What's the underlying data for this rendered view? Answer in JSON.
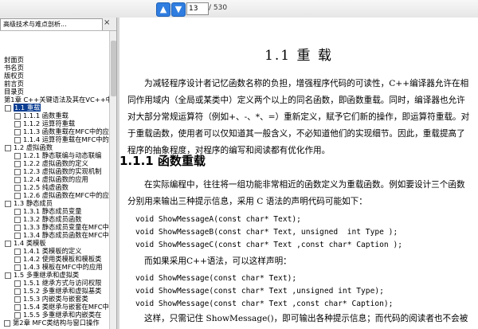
{
  "toolbar": {
    "page_current": "13",
    "page_total": "/ 530",
    "up_icon": "arrow-up-icon",
    "down_icon": "arrow-down-icon"
  },
  "tab": {
    "title": "高级技术与难点剖析...",
    "close": "×"
  },
  "tree": [
    {
      "label": "封面页",
      "indent": 5,
      "box": ""
    },
    {
      "label": "书名页",
      "indent": 5,
      "box": ""
    },
    {
      "label": "版权页",
      "indent": 5,
      "box": ""
    },
    {
      "label": "前言页",
      "indent": 5,
      "box": ""
    },
    {
      "label": "目录页",
      "indent": 5,
      "box": ""
    },
    {
      "label": "第1章  C++关键语法及其在VC++中的",
      "indent": 5,
      "box": ""
    },
    {
      "label": "1.1 重载",
      "indent": 6,
      "box": "-",
      "sel": true
    },
    {
      "label": "1.1.1 函数重载",
      "indent": 18,
      "box": " "
    },
    {
      "label": "1.1.2 运算符重载",
      "indent": 18,
      "box": " "
    },
    {
      "label": "1.1.3 函数重载在MFC中的应",
      "indent": 18,
      "box": " "
    },
    {
      "label": "1.1.4 运算符重载在MFC中的",
      "indent": 18,
      "box": " "
    },
    {
      "label": "1.2 虚拟函数",
      "indent": 6,
      "box": "-"
    },
    {
      "label": "1.2.1 静态联编与动态联编",
      "indent": 18,
      "box": " "
    },
    {
      "label": "1.2.2 虚拟函数的定义",
      "indent": 18,
      "box": " "
    },
    {
      "label": "1.2.3 虚拟函数的实现机制",
      "indent": 18,
      "box": " "
    },
    {
      "label": "1.2.4 虚拟函数的应用",
      "indent": 18,
      "box": " "
    },
    {
      "label": "1.2.5 纯虚函数",
      "indent": 18,
      "box": " "
    },
    {
      "label": "1.2.6 虚拟函数在MFC中的应",
      "indent": 18,
      "box": " "
    },
    {
      "label": "1.3 静态成员",
      "indent": 6,
      "box": "-"
    },
    {
      "label": "1.3.1 静态成员变量",
      "indent": 18,
      "box": " "
    },
    {
      "label": "1.3.2 静态成员函数",
      "indent": 18,
      "box": " "
    },
    {
      "label": "1.3.3 静态成员变量在MFC中",
      "indent": 18,
      "box": " "
    },
    {
      "label": "1.3.4 静态成员函数在MFC中",
      "indent": 18,
      "box": " "
    },
    {
      "label": "1.4 类模板",
      "indent": 6,
      "box": "-"
    },
    {
      "label": "1.4.1 类模板的定义",
      "indent": 18,
      "box": " "
    },
    {
      "label": "1.4.2 使用类模板和模板类",
      "indent": 18,
      "box": " "
    },
    {
      "label": "1.4.3 模板在MFC中的应用",
      "indent": 18,
      "box": " "
    },
    {
      "label": "1.5 多重继承和虚拟类",
      "indent": 6,
      "box": "-"
    },
    {
      "label": "1.5.1 继承方式与访问权限",
      "indent": 18,
      "box": " "
    },
    {
      "label": "1.5.2 多重继承和虚拟基类",
      "indent": 18,
      "box": " "
    },
    {
      "label": "1.5.3 内嵌类与嵌套类",
      "indent": 18,
      "box": " "
    },
    {
      "label": "1.5.4 类继承与嵌套在MFC中",
      "indent": 18,
      "box": " "
    },
    {
      "label": "1.5.5 多重继承和内嵌类在",
      "indent": 18,
      "box": " "
    },
    {
      "label": "第2章  MFC类结构与窗口操作",
      "indent": 5,
      "box": "+"
    }
  ],
  "content": {
    "section_title": "1.1  重    载",
    "para1": "为减轻程序设计者记忆函数名称的负担，增强程序代码的可读性，C++编译器允许在相同作用域内（全局或某类中）定义两个以上的同名函数，即函数重载。同时，编译器也允许对大部分常规运算符（例如+、-、*、=）重新定义，赋予它们新的操作，即运算符重载。对于重载函数，使用者可以仅知道其一般含义，不必知道他们的实现细节。因此，重载提高了程序的抽象程度，对程序的编写和阅读都有优化作用。",
    "h2": "1.1.1   函数重载",
    "para2": "在实际编程中，往往将一组功能非常相近的函数定义为重载函数。例如要设计三个函数分别用来输出三种提示信息，采用 C 语法的声明代码可能如下：",
    "code1": [
      "void ShowMessageA(const char* Text);",
      "void ShowMessageB(const char* Text, unsigned  int Type );",
      "void ShowMessageC(const char* Text ,const char* Caption );"
    ],
    "para3": "而如果采用C++语法，可以这样声明：",
    "code2": [
      "void ShowMessage(const char* Text);",
      "void ShowMessage(const char* Text ,unsigned int Type);",
      "void ShowMessage(const char* Text ,const char* Caption);"
    ],
    "para4": "这样，只需记住 ShowMessage()，即可输出各种提示信息；而代码的阅读者也不会被"
  }
}
